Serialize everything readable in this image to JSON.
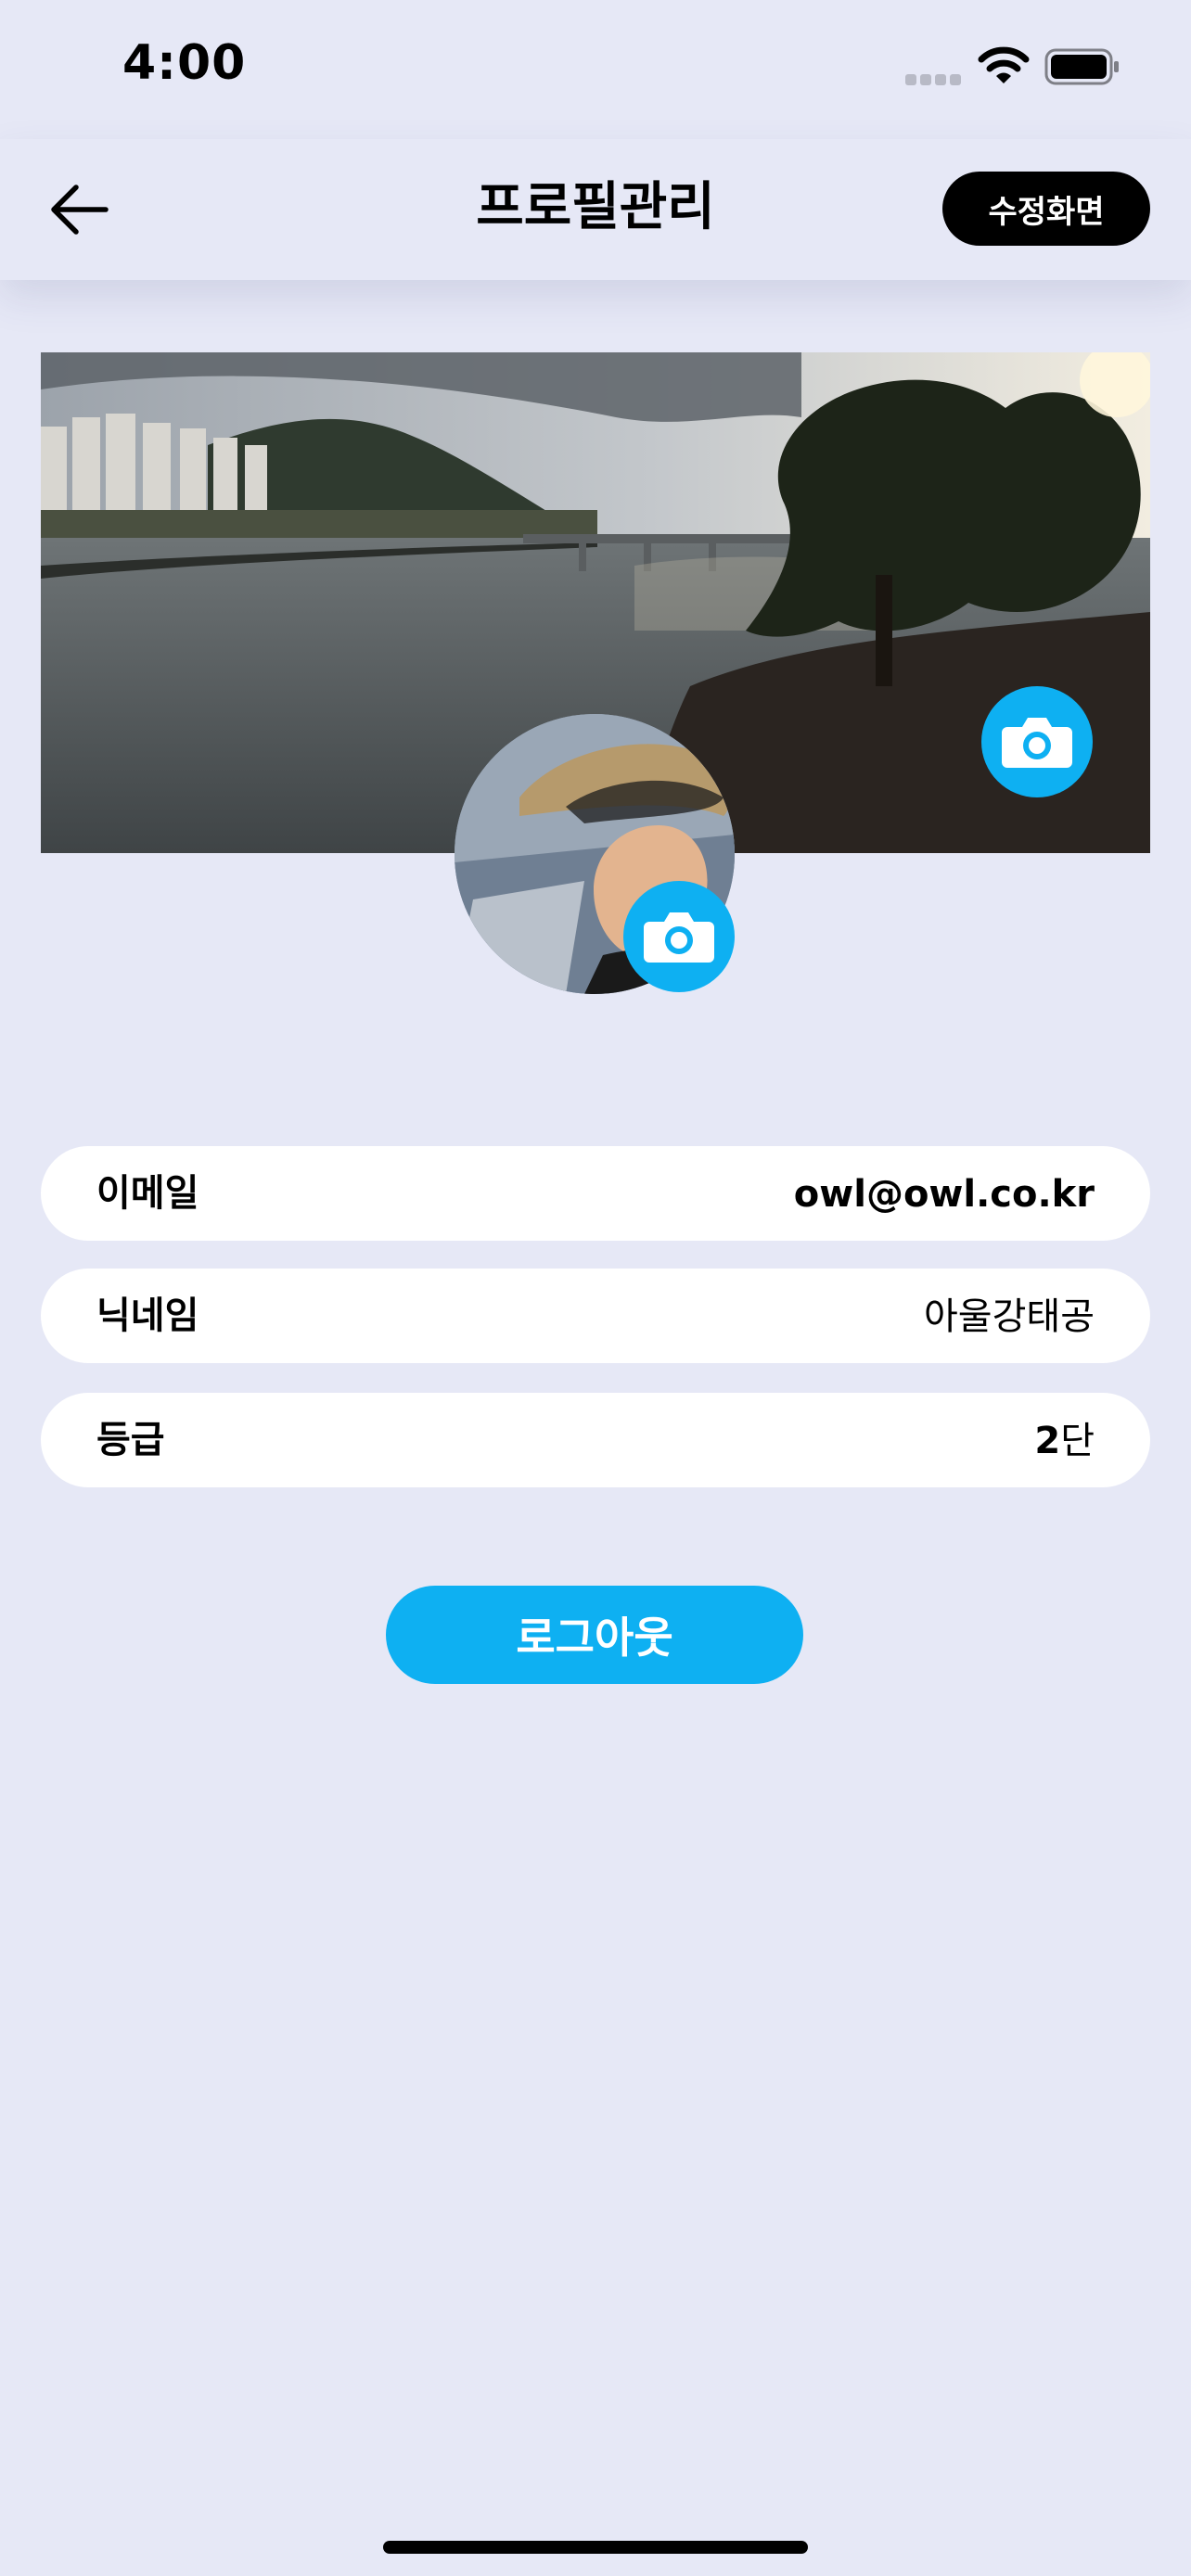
{
  "status_bar": {
    "time": "4:00",
    "signal_icon": "cellular-signal-icon",
    "wifi_icon": "wifi-icon",
    "battery_icon": "battery-icon"
  },
  "header": {
    "back_icon": "arrow-left-icon",
    "title": "프로필관리",
    "edit_label": "수정화면"
  },
  "profile": {
    "cover_camera_icon": "camera-icon",
    "avatar_camera_icon": "camera-icon"
  },
  "info": [
    {
      "label": "이메일",
      "value": "owl@owl.co.kr"
    },
    {
      "label": "닉네임",
      "value": "아울강태공"
    },
    {
      "label": "등급",
      "value_number": "2",
      "value_unit": "단"
    }
  ],
  "logout_label": "로그아웃",
  "colors": {
    "background": "#e6e8f6",
    "accent": "#0eb0f2",
    "button_dark": "#000000",
    "field_bg": "#ffffff"
  }
}
